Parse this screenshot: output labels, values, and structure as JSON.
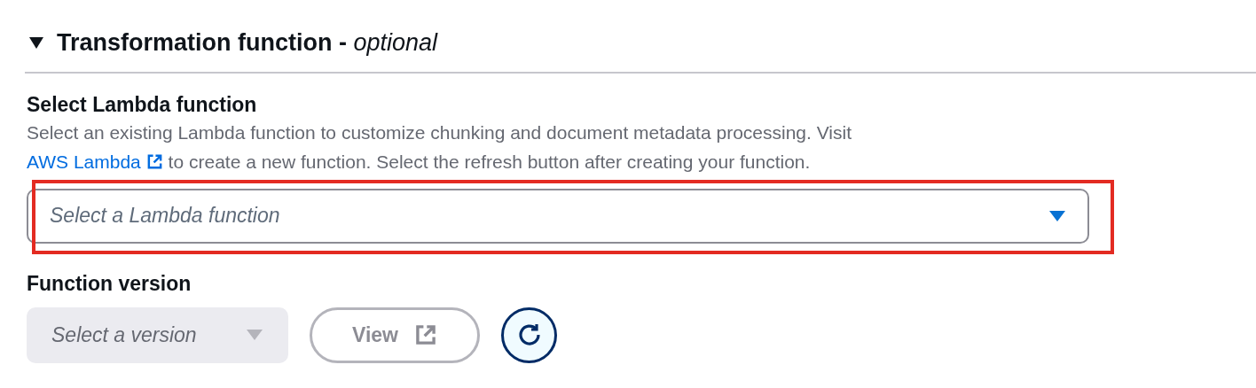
{
  "section": {
    "title": "Transformation function - ",
    "title_suffix": "optional",
    "expanded": true
  },
  "lambda_field": {
    "label": "Select Lambda function",
    "description_before": "Select an existing Lambda function to customize chunking and document metadata processing. Visit ",
    "link": "AWS Lambda",
    "description_after": " to create a new function. Select the refresh button after creating your function.",
    "placeholder": "Select a Lambda function",
    "highlighted": true
  },
  "version_field": {
    "label": "Function version",
    "placeholder": "Select a version",
    "disabled": true
  },
  "view_button": {
    "label": "View",
    "disabled": true
  }
}
